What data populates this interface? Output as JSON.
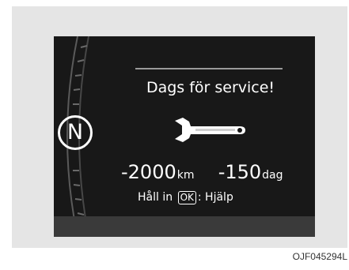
{
  "screen": {
    "gear_indicator": "N",
    "message": "Dags för service!",
    "icon": "wrench-icon",
    "distance_value": "-2000",
    "distance_unit": "km",
    "days_value": "-150",
    "days_unit": "dag",
    "help_prefix": "Håll in",
    "help_key": "OK",
    "help_suffix": ": Hjälp"
  },
  "figure_code": "OJF045294L"
}
